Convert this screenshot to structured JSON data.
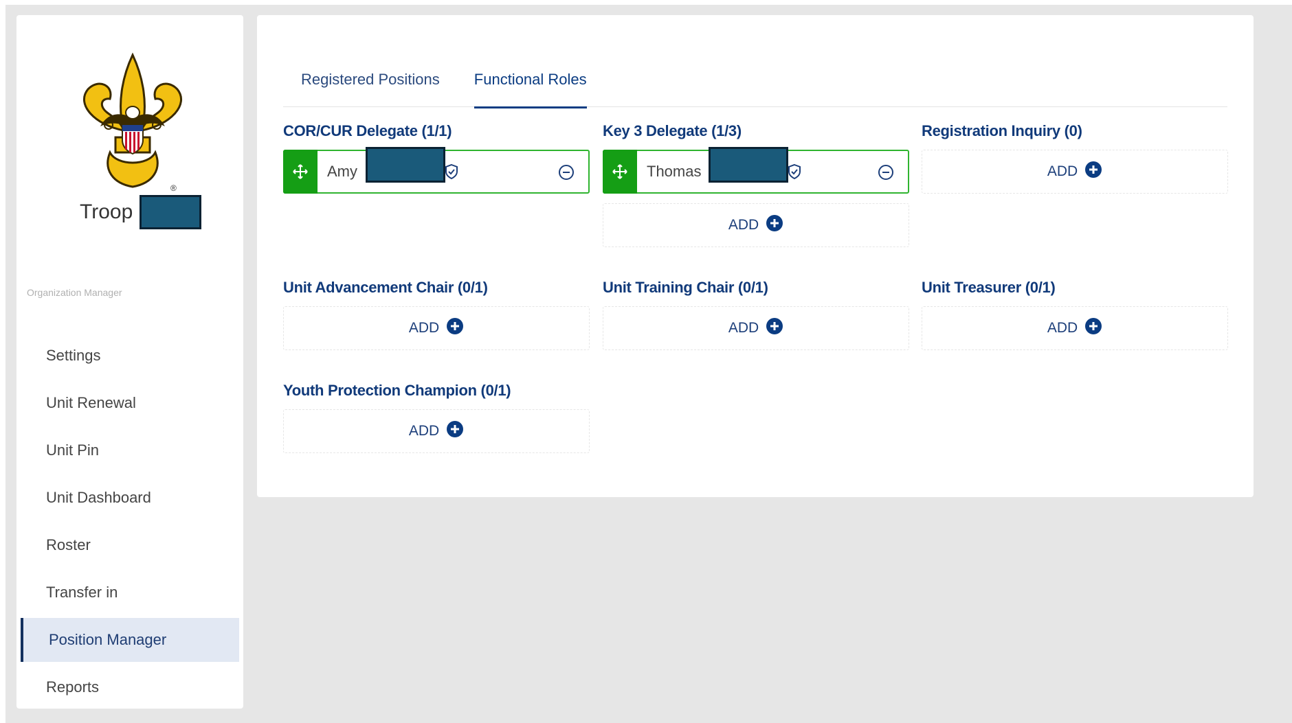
{
  "sidebar": {
    "troop_label": "Troop",
    "section_caption": "Organization Manager",
    "items": [
      {
        "label": "Settings"
      },
      {
        "label": "Unit Renewal"
      },
      {
        "label": "Unit Pin"
      },
      {
        "label": "Unit Dashboard"
      },
      {
        "label": "Roster"
      },
      {
        "label": "Transfer in"
      },
      {
        "label": "Position Manager",
        "active": true
      },
      {
        "label": "Reports"
      }
    ]
  },
  "tabs": [
    {
      "label": "Registered Positions"
    },
    {
      "label": "Functional Roles",
      "active": true
    }
  ],
  "roles": {
    "cor": {
      "title": "COR/CUR Delegate (1/1)",
      "person": "Amy"
    },
    "key3": {
      "title": "Key 3 Delegate (1/3)",
      "person": "Thomas",
      "add_label": "ADD"
    },
    "inquiry": {
      "title": "Registration Inquiry (0)",
      "add_label": "ADD"
    },
    "advancement": {
      "title": "Unit Advancement Chair (0/1)",
      "add_label": "ADD"
    },
    "training": {
      "title": "Unit Training Chair (0/1)",
      "add_label": "ADD"
    },
    "treasurer": {
      "title": "Unit Treasurer (0/1)",
      "add_label": "ADD"
    },
    "youth": {
      "title": "Youth Protection Champion (0/1)",
      "add_label": "ADD"
    }
  },
  "colors": {
    "accent_navy": "#0b3c82",
    "card_green": "#2fb42f",
    "handle_green": "#159e15",
    "redaction": "#1a5a7a"
  },
  "icons": {
    "drag": "move-arrows-icon",
    "verified": "shield-check-icon",
    "remove": "minus-circle-icon",
    "add": "plus-circle-icon"
  }
}
